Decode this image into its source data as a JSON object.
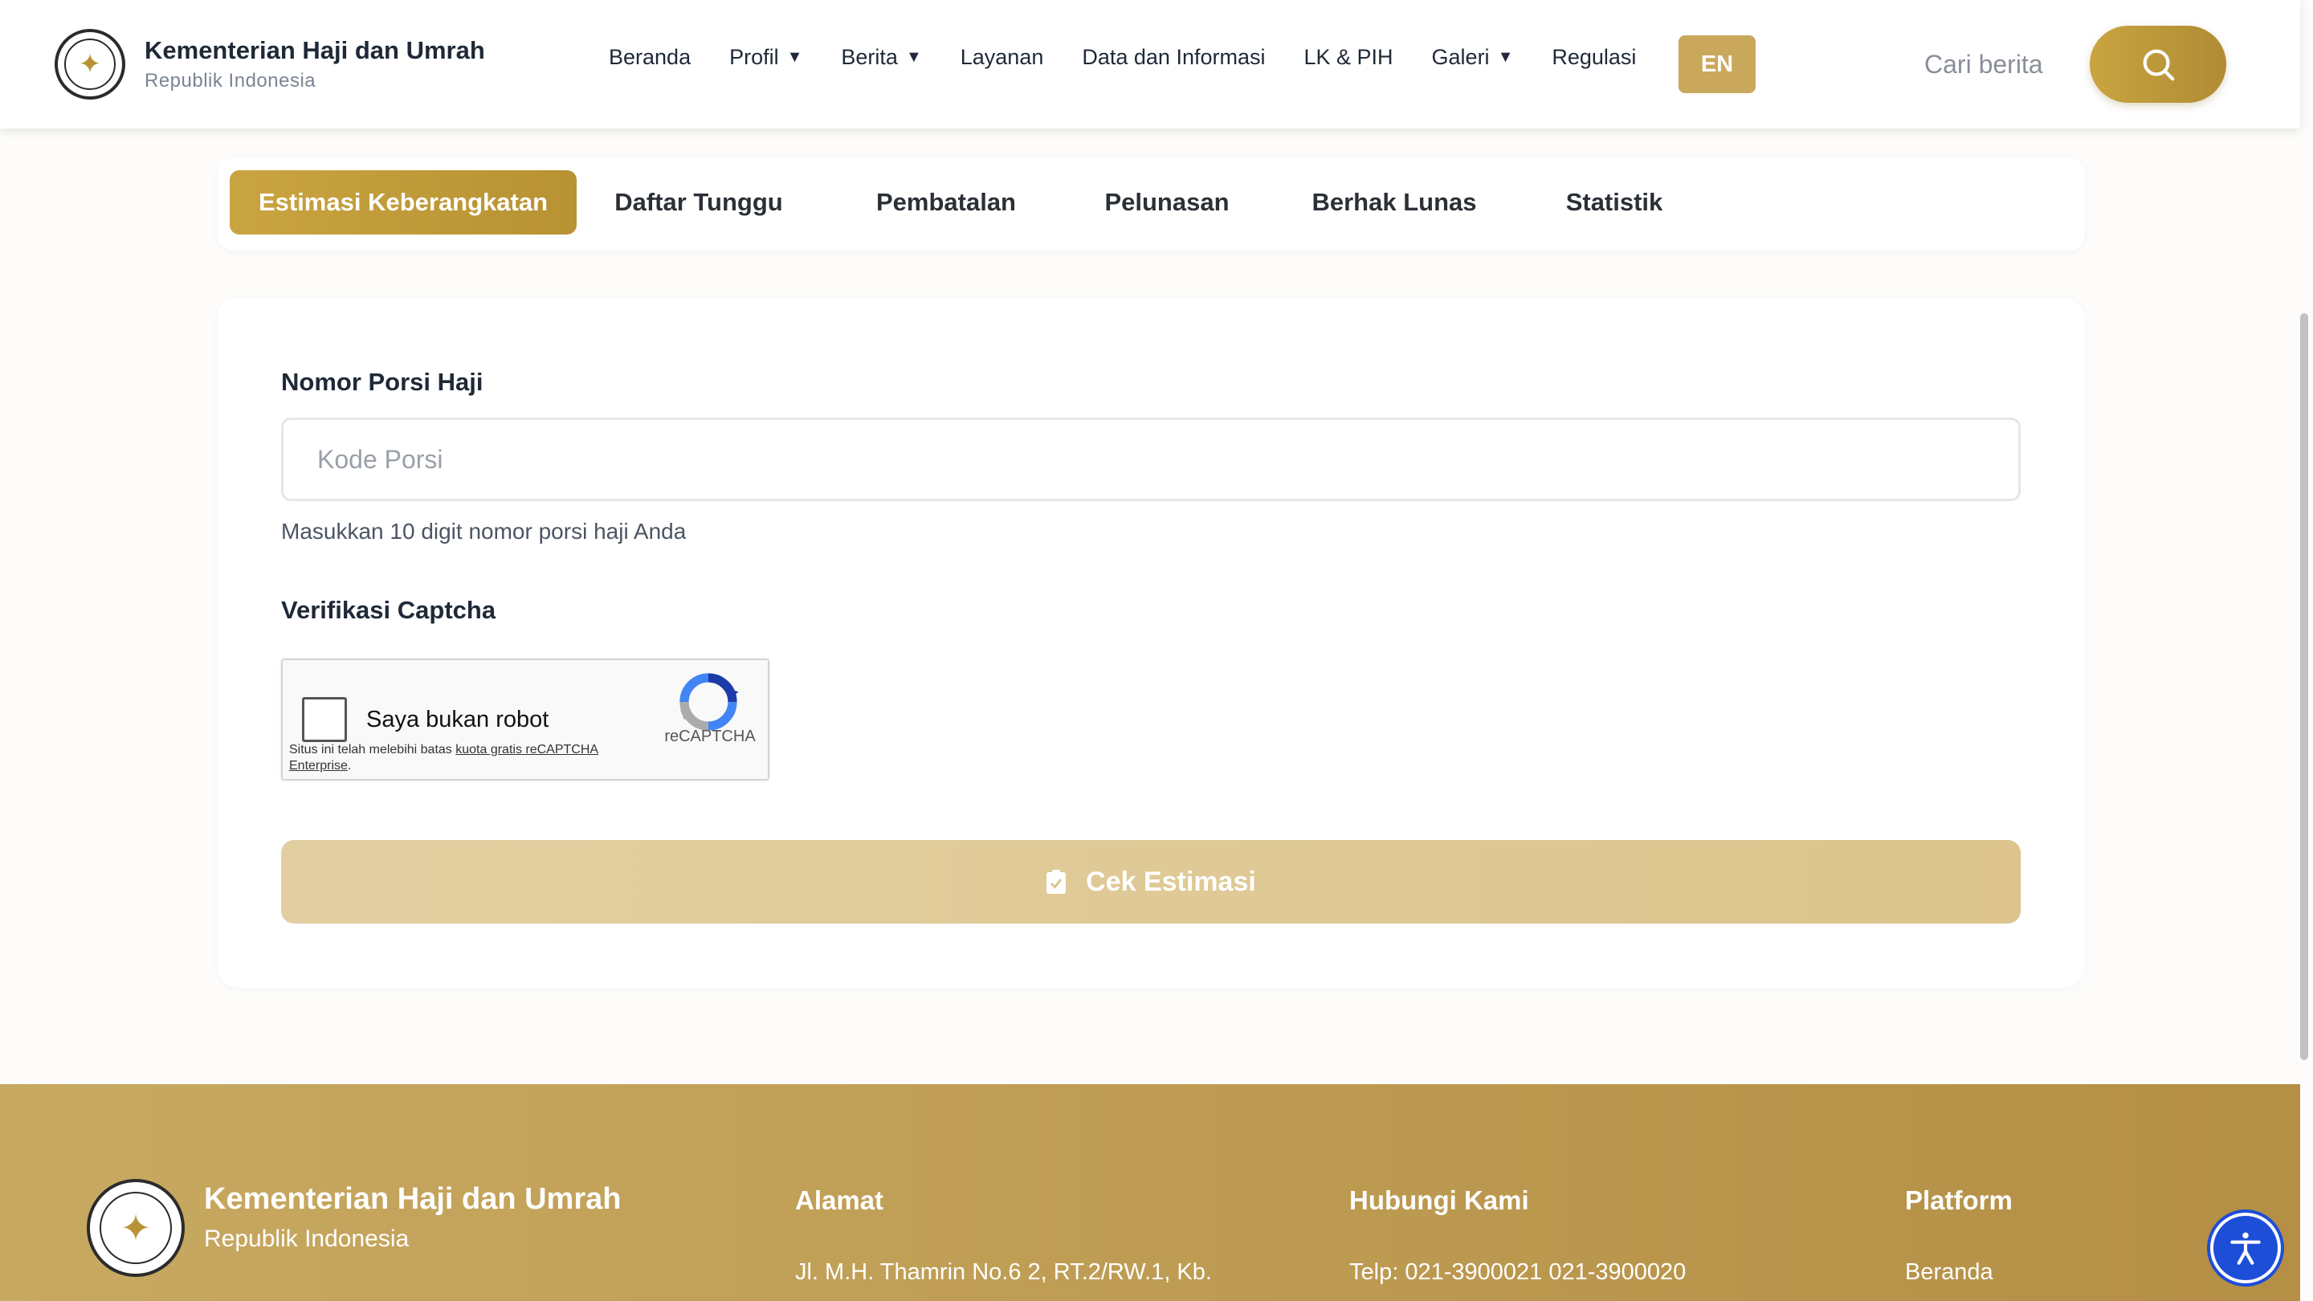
{
  "header": {
    "brand_title": "Kementerian Haji dan Umrah",
    "brand_sub": "Republik Indonesia",
    "nav": [
      {
        "label": "Beranda"
      },
      {
        "label": "Profil",
        "dropdown": true
      },
      {
        "label": "Berita",
        "dropdown": true
      },
      {
        "label": "Layanan"
      },
      {
        "label": "Data dan Informasi"
      },
      {
        "label": "LK & PIH"
      },
      {
        "label": "Galeri",
        "dropdown": true
      },
      {
        "label": "Regulasi"
      }
    ],
    "lang": "EN",
    "search_placeholder": "Cari berita",
    "accent": "#c9a440"
  },
  "tabs": [
    {
      "label": "Estimasi Keberangkatan",
      "active": true
    },
    {
      "label": "Daftar Tunggu"
    },
    {
      "label": "Pembatalan"
    },
    {
      "label": "Pelunasan"
    },
    {
      "label": "Berhak Lunas"
    },
    {
      "label": "Statistik"
    }
  ],
  "form": {
    "porsi_label": "Nomor Porsi Haji",
    "porsi_placeholder": "Kode Porsi",
    "porsi_value": "",
    "porsi_help": "Masukkan 10 digit nomor porsi haji Anda",
    "captcha_label": "Verifikasi Captcha",
    "captcha": {
      "checkbox_label": "Saya bukan robot",
      "brand": "reCAPTCHA",
      "note_prefix": "Situs ini telah melebihi batas ",
      "note_link": "kuota gratis reCAPTCHA Enterprise",
      "note_suffix": ".",
      "checked": false
    },
    "submit_label": "Cek Estimasi"
  },
  "footer": {
    "brand_title": "Kementerian Haji dan Umrah",
    "brand_sub": "Republik Indonesia",
    "columns": [
      {
        "heading": "Alamat",
        "text": "Jl. M.H. Thamrin No.6 2, RT.2/RW.1, Kb."
      },
      {
        "heading": "Hubungi Kami",
        "text": "Telp: 021-3900021 021-3900020"
      },
      {
        "heading": "Platform",
        "text": "Beranda"
      }
    ]
  },
  "icons": {
    "search": "search-icon",
    "caret": "chevron-down-icon",
    "clipboard": "clipboard-check-icon",
    "accessibility": "accessibility-icon"
  }
}
